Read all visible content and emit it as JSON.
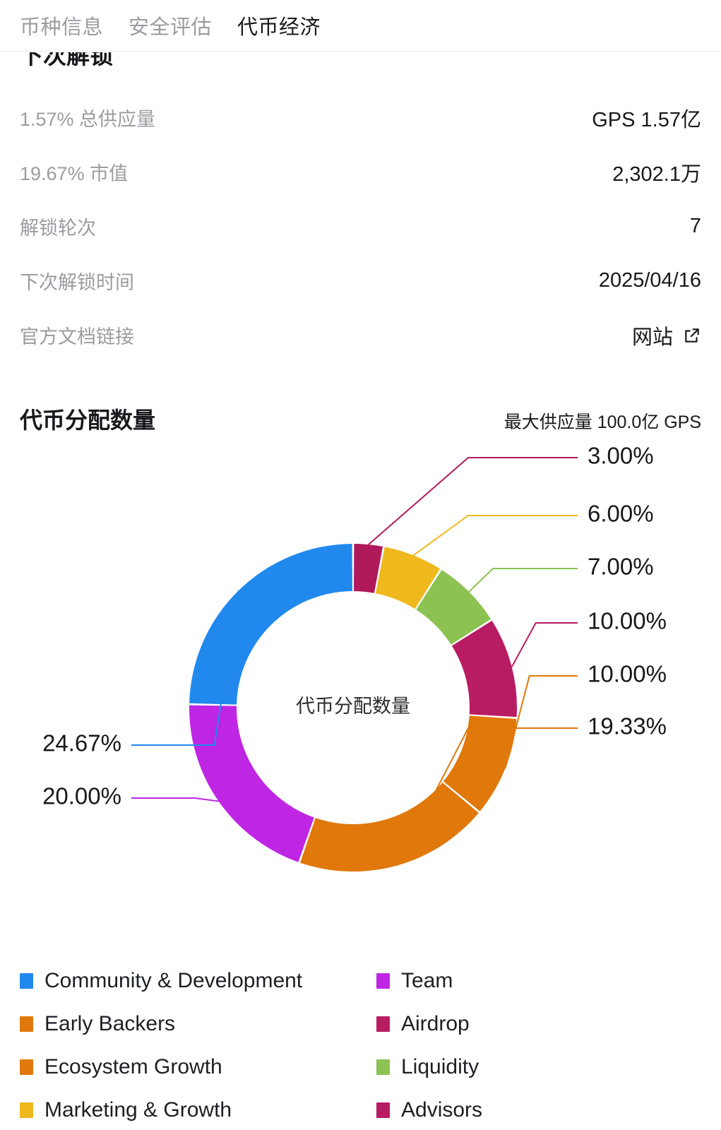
{
  "tabs": [
    {
      "label": "币种信息",
      "active": false
    },
    {
      "label": "安全评估",
      "active": false
    },
    {
      "label": "代币经济",
      "active": true
    }
  ],
  "clipped_section_title": "下次解锁",
  "info_rows": [
    {
      "label": "1.57% 总供应量",
      "value": "GPS 1.57亿"
    },
    {
      "label": "19.67% 市值",
      "value": "2,302.1万"
    },
    {
      "label": "解锁轮次",
      "value": "7"
    },
    {
      "label": "下次解锁时间",
      "value": "2025/04/16"
    },
    {
      "label": "官方文档链接",
      "value": "网站",
      "icon": "external-link-icon"
    }
  ],
  "chart_header": {
    "title": "代币分配数量",
    "supply": "最大供应量 100.0亿 GPS"
  },
  "chart_data": {
    "type": "pie",
    "title": "代币分配数量",
    "center_label": "代币分配数量",
    "max_supply": "100.0亿 GPS",
    "legend_position": "bottom",
    "categories": [
      "Advisors",
      "Marketing & Growth",
      "Liquidity",
      "Airdrop",
      "Ecosystem Growth",
      "Early Backers",
      "Team",
      "Community & Development"
    ],
    "values": [
      3.0,
      6.0,
      7.0,
      10.0,
      10.0,
      19.33,
      20.0,
      24.67
    ],
    "labels": [
      "3.00%",
      "6.00%",
      "7.00%",
      "10.00%",
      "10.00%",
      "19.33%",
      "20.00%",
      "24.67%"
    ],
    "colors": [
      "#B01A5B",
      "#EFB81C",
      "#8CC252",
      "#B81C62",
      "#E0780C",
      "#E0780C",
      "#BE26E4",
      "#2189EE"
    ]
  },
  "legend": [
    {
      "label": "Community & Development",
      "color": "#2189EE"
    },
    {
      "label": "Team",
      "color": "#BE26E4"
    },
    {
      "label": "Early Backers",
      "color": "#E0780C"
    },
    {
      "label": "Airdrop",
      "color": "#B81C62"
    },
    {
      "label": "Ecosystem Growth",
      "color": "#E0780C"
    },
    {
      "label": "Liquidity",
      "color": "#8CC252"
    },
    {
      "label": "Marketing & Growth",
      "color": "#EFB81C"
    },
    {
      "label": "Advisors",
      "color": "#B81C62"
    }
  ]
}
